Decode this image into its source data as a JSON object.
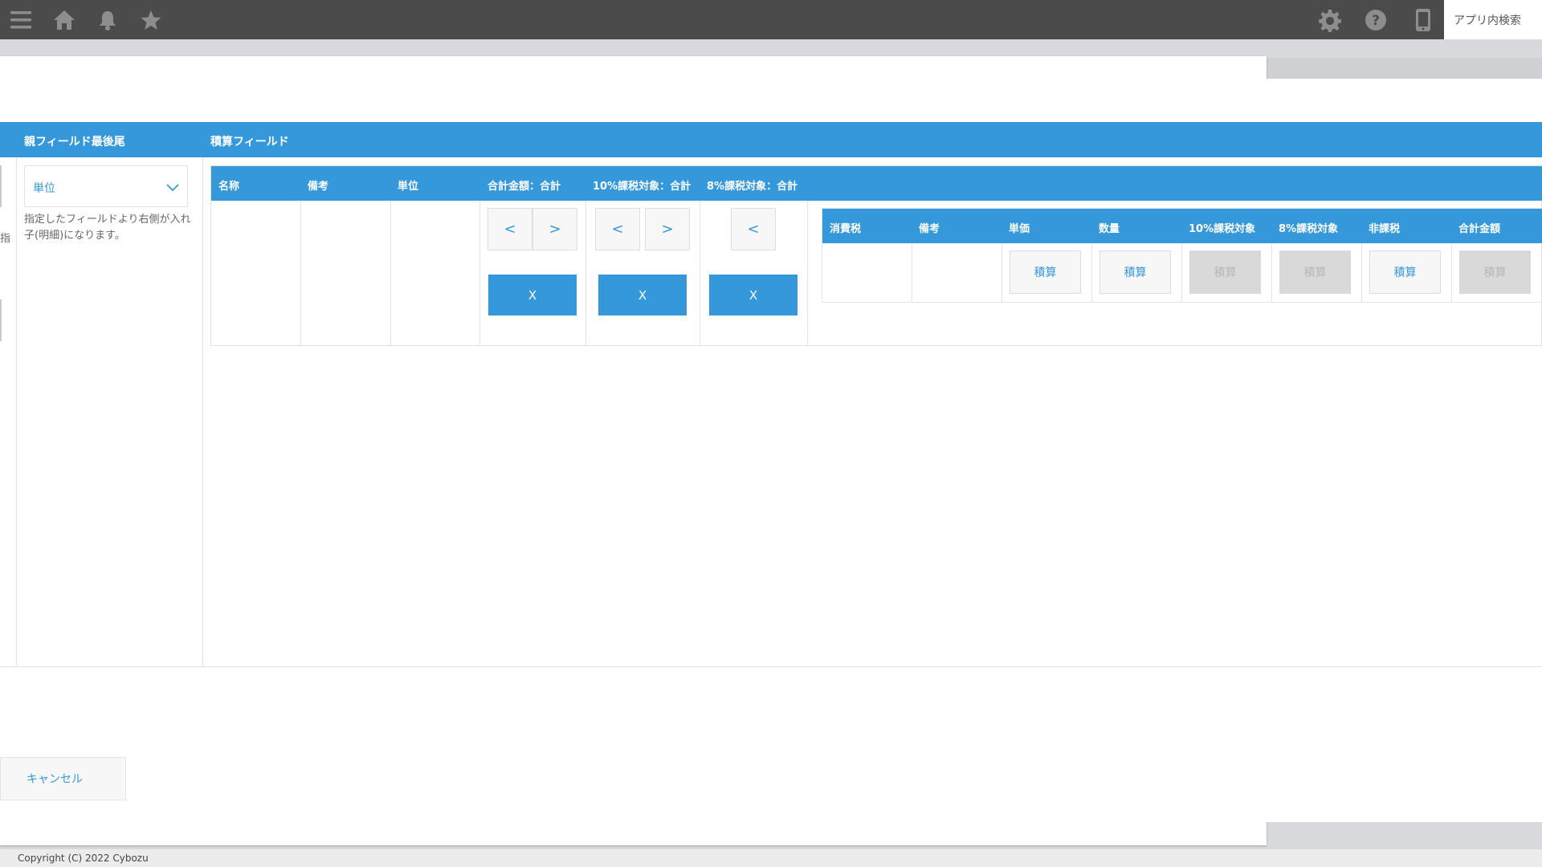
{
  "header": {
    "icons": [
      "menu-icon",
      "home-icon",
      "bell-icon",
      "star-icon",
      "gear-icon",
      "help-icon",
      "mobile-icon"
    ],
    "search_label": "アプリ内検索"
  },
  "section": {
    "left_label": "親フィールド最後尾",
    "right_label": "積算フィールド"
  },
  "left_panel": {
    "fragment_char": "指",
    "select_value": "単位",
    "help_text": "指定したフィールドより右側が入れ子(明細)になります。"
  },
  "main_table": {
    "columns": [
      "名称",
      "備考",
      "単位",
      "合計金額：合計",
      "10%課税対象：合計",
      "8%課税対象：合計"
    ],
    "nav_buttons": {
      "prev": "<",
      "next": ">"
    },
    "remove_label": "X"
  },
  "sub_table": {
    "columns": [
      "消費税",
      "備考",
      "単価",
      "数量",
      "10%課税対象",
      "8%課税対象",
      "非課税",
      "合計金額"
    ],
    "calc_label": "積算",
    "calc_states": [
      "none",
      "none",
      "enabled",
      "enabled",
      "disabled",
      "disabled",
      "enabled",
      "disabled"
    ]
  },
  "actions": {
    "cancel_label": "キャンセル"
  },
  "footer": {
    "copyright": "Copyright (C) 2022 Cybozu"
  },
  "colors": {
    "accent": "#3498db",
    "topbar": "#4b4b4b",
    "disabled": "#d9d9d9"
  }
}
